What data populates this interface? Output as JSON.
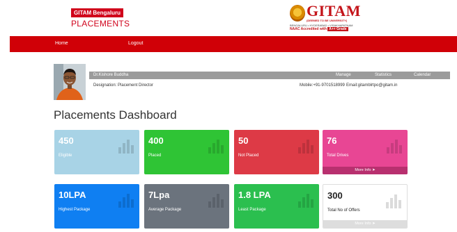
{
  "brand": {
    "title": "GITAM Bengaluru",
    "subtitle": "PLACEMENTS"
  },
  "logo": {
    "name": "GITAM",
    "university": "(DEEMED TO BE UNIVERSITY)",
    "cities": "BENGALURU • HYDERABAD • VISAKHAPATNAM",
    "naac": "NAAC Accredited with",
    "grade": "A++ Grade"
  },
  "nav": {
    "home": "Home",
    "logout": "Logout"
  },
  "profile": {
    "name": "Dr.Kishore Buddha",
    "designation": "Designation: Placement Director",
    "mobile": "Mobile:+91-9701518999",
    "email": "Email:gitamblrtpo@gitam.in",
    "links": {
      "manage": "Manage",
      "statistics": "Statistics",
      "calendar": "Calendar"
    }
  },
  "dashboard": {
    "title": "Placements Dashboard",
    "tiles": [
      {
        "value": "450",
        "label": "Eligible",
        "color": "#a8d3e6"
      },
      {
        "value": "400",
        "label": "Placed",
        "color": "#2fc435"
      },
      {
        "value": "50",
        "label": "Not Placed",
        "color": "#dd3a46"
      },
      {
        "value": "76",
        "label": "Total Drives",
        "color": "#e84694",
        "more": "More Info"
      },
      {
        "value": "10LPA",
        "label": "Highest Package",
        "color": "#0f7ff2"
      },
      {
        "value": "7Lpa",
        "label": "Average Package",
        "color": "#6b737d"
      },
      {
        "value": "1.8 LPA",
        "label": "Least Package",
        "color": "#2bbf4f"
      },
      {
        "value": "300",
        "label": "Total No of Offers",
        "color": "#ffffff",
        "more": "More Info"
      }
    ]
  }
}
